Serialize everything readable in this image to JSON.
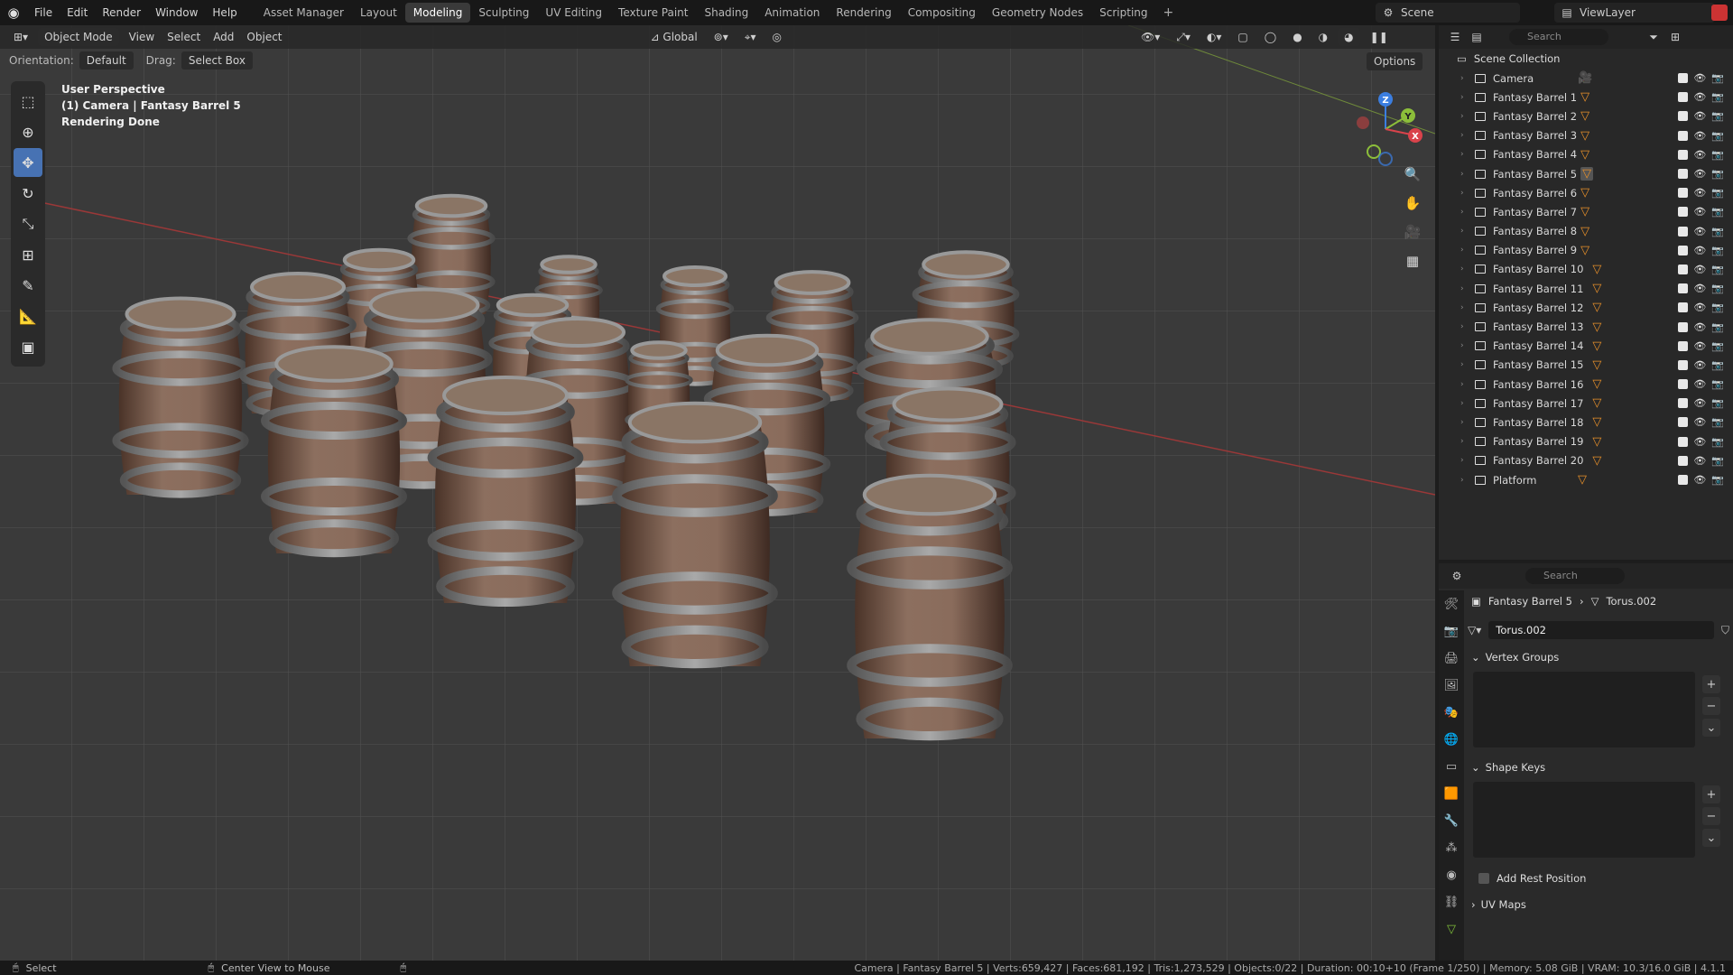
{
  "topbar": {
    "menu": [
      "File",
      "Edit",
      "Render",
      "Window",
      "Help"
    ],
    "workspaces": [
      "Asset Manager",
      "Layout",
      "Modeling",
      "Sculpting",
      "UV Editing",
      "Texture Paint",
      "Shading",
      "Animation",
      "Rendering",
      "Compositing",
      "Geometry Nodes",
      "Scripting"
    ],
    "active_workspace": "Modeling",
    "add_tab": "+",
    "scene": "Scene",
    "view_layer": "ViewLayer"
  },
  "viewport": {
    "mode": "Object Mode",
    "menus": [
      "View",
      "Select",
      "Add",
      "Object"
    ],
    "transform": "Global",
    "orientation_label": "Orientation:",
    "orientation_value": "Default",
    "drag_label": "Drag:",
    "drag_value": "Select Box",
    "options": "Options",
    "overlay_line1": "User Perspective",
    "overlay_line2": "(1) Camera | Fantasy Barrel 5",
    "overlay_line3": "Rendering Done",
    "gizmo_x": "X",
    "gizmo_y": "Y",
    "gizmo_z": "Z"
  },
  "outliner": {
    "search_placeholder": "Search",
    "collection": "Scene Collection",
    "items": [
      {
        "name": "Camera",
        "type": "camera"
      },
      {
        "name": "Fantasy Barrel 1",
        "type": "mesh"
      },
      {
        "name": "Fantasy Barrel 2",
        "type": "mesh"
      },
      {
        "name": "Fantasy Barrel 3",
        "type": "mesh"
      },
      {
        "name": "Fantasy Barrel 4",
        "type": "mesh"
      },
      {
        "name": "Fantasy Barrel 5",
        "type": "mesh"
      },
      {
        "name": "Fantasy Barrel 6",
        "type": "mesh"
      },
      {
        "name": "Fantasy Barrel 7",
        "type": "mesh"
      },
      {
        "name": "Fantasy Barrel 8",
        "type": "mesh"
      },
      {
        "name": "Fantasy Barrel 9",
        "type": "mesh"
      },
      {
        "name": "Fantasy Barrel 10",
        "type": "mesh"
      },
      {
        "name": "Fantasy Barrel 11",
        "type": "mesh"
      },
      {
        "name": "Fantasy Barrel 12",
        "type": "mesh"
      },
      {
        "name": "Fantasy Barrel 13",
        "type": "mesh"
      },
      {
        "name": "Fantasy Barrel 14",
        "type": "mesh"
      },
      {
        "name": "Fantasy Barrel 15",
        "type": "mesh"
      },
      {
        "name": "Fantasy Barrel 16",
        "type": "mesh"
      },
      {
        "name": "Fantasy Barrel 17",
        "type": "mesh"
      },
      {
        "name": "Fantasy Barrel 18",
        "type": "mesh"
      },
      {
        "name": "Fantasy Barrel 19",
        "type": "mesh"
      },
      {
        "name": "Fantasy Barrel 20",
        "type": "mesh"
      },
      {
        "name": "Platform",
        "type": "mesh"
      }
    ]
  },
  "properties": {
    "search_placeholder": "Search",
    "object": "Fantasy Barrel 5",
    "mesh": "Torus.002",
    "datablock": "Torus.002",
    "panels": {
      "vertex_groups": "Vertex Groups",
      "shape_keys": "Shape Keys",
      "add_rest_position": "Add Rest Position",
      "uv_maps": "UV Maps"
    }
  },
  "statusbar": {
    "select": "Select",
    "center_view": "Center View to Mouse",
    "stats": "Camera | Fantasy Barrel 5 | Verts:659,427 | Faces:681,192 | Tris:1,273,529 | Objects:0/22 | Duration: 00:10+10 (Frame 1/250) | Memory: 5.08 GiB | VRAM: 10.3/16.0 GiB | 4.1.1"
  },
  "colors": {
    "accent": "#4772b3",
    "mesh_icon": "#e8902a",
    "axis_x": "#d9434b",
    "axis_y": "#8cbe3a",
    "axis_z": "#3b7ee0"
  }
}
